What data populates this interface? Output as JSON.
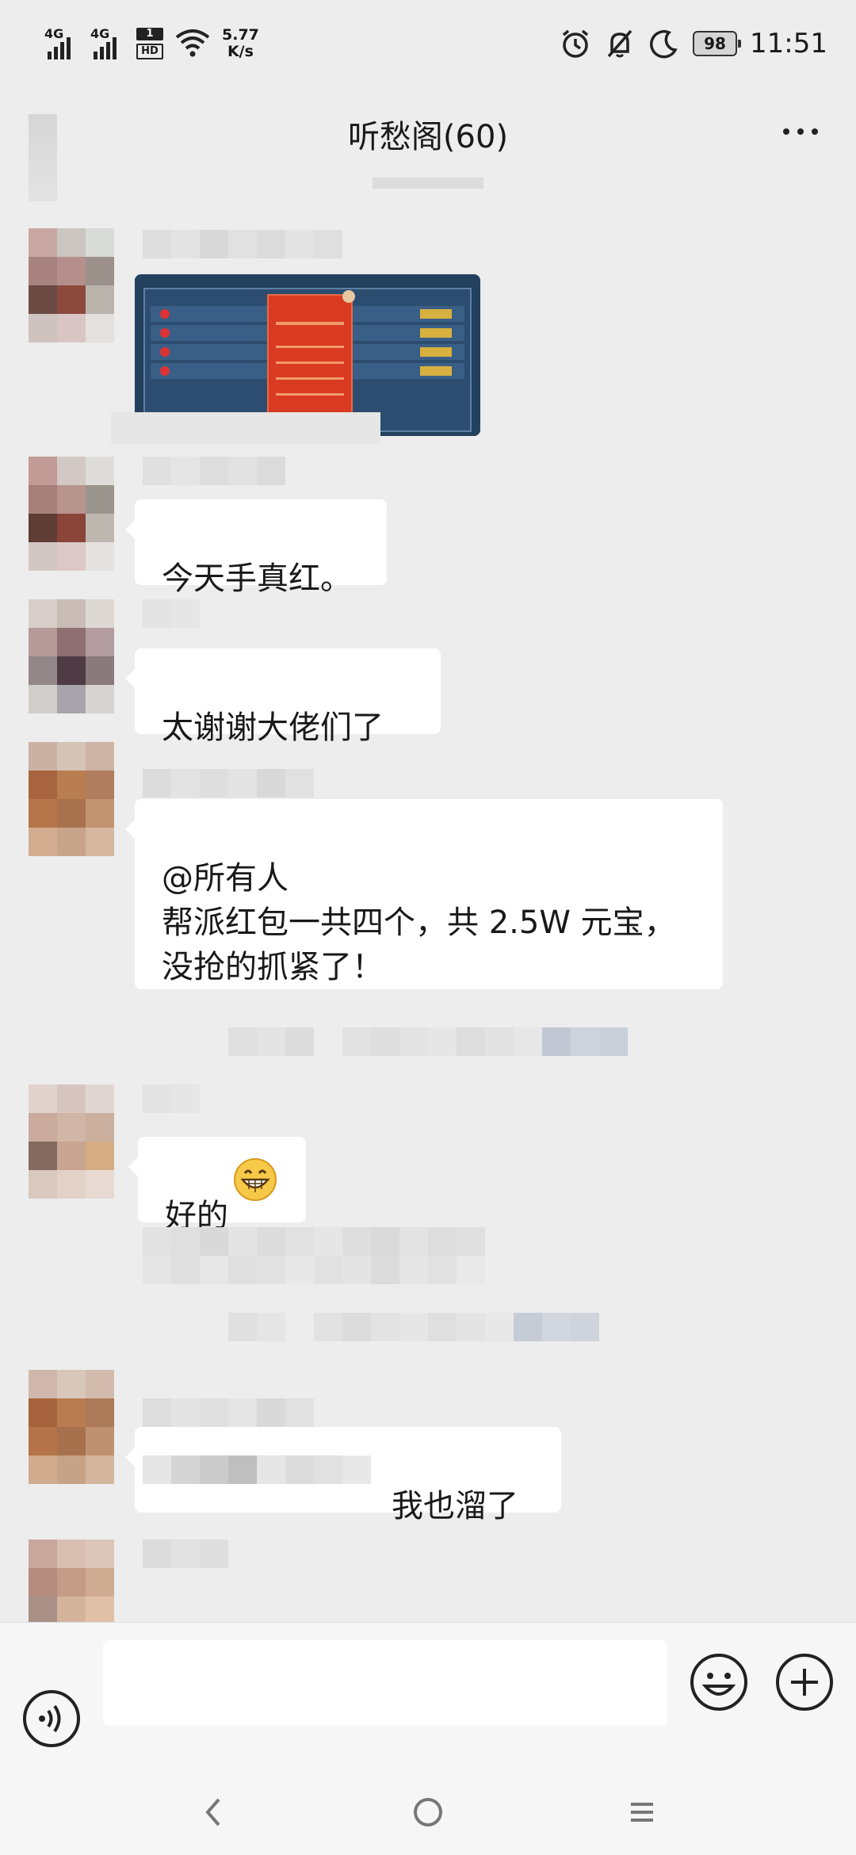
{
  "status_bar": {
    "signal1": "4G",
    "signal2": "4G",
    "hd_num": "1",
    "hd_label": "HD",
    "speed_value": "5.77",
    "speed_unit": "K/s",
    "battery": "98",
    "time": "11:51"
  },
  "header": {
    "title": "听愁阁(60)"
  },
  "messages": {
    "m2": {
      "text": "今天手真红。"
    },
    "m3": {
      "text": "太谢谢大佬们了"
    },
    "m4": {
      "text": "@所有人\n帮派红包一共四个，共 2.5W 元宝，\n没抢的抓紧了！"
    },
    "m5": {
      "text": "好的"
    },
    "m6": {
      "text": "我也溜了"
    }
  },
  "icons": {
    "voice": "voice-icon",
    "emoji": "emoji-icon",
    "add": "plus-icon",
    "nav_back": "back-icon",
    "nav_home": "home-icon",
    "nav_menu": "menu-icon"
  },
  "colors": {
    "background": "#ededed",
    "bubble": "#ffffff",
    "text": "#191919",
    "redpacket": "#d93a22"
  }
}
